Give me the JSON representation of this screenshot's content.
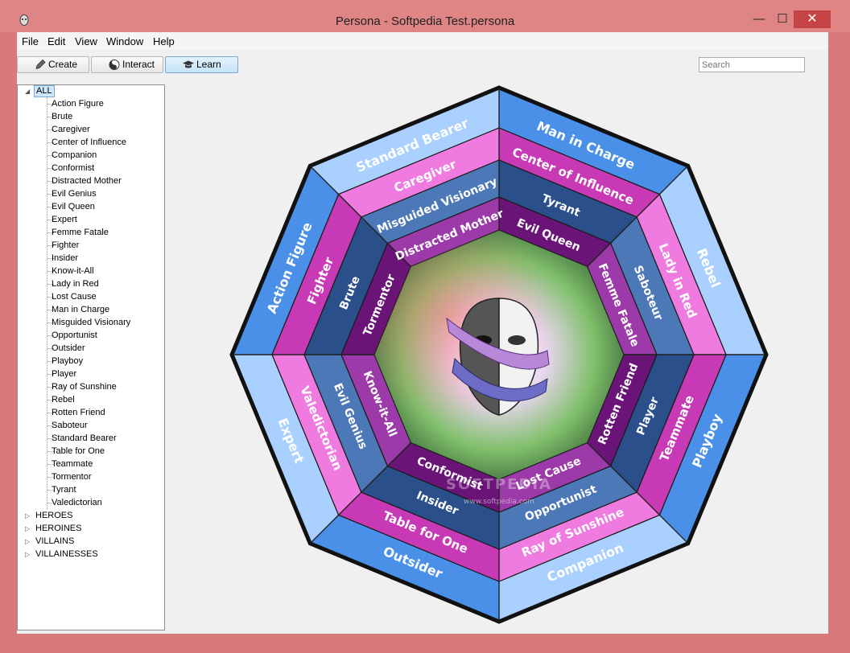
{
  "window": {
    "title": "Persona - Softpedia Test.persona",
    "minimize": "—",
    "maximize": "☐",
    "close": "✕"
  },
  "menu": [
    "File",
    "Edit",
    "View",
    "Window",
    "Help"
  ],
  "toolbar": {
    "buttons": [
      {
        "label": "Create",
        "icon": "pencil-icon"
      },
      {
        "label": "Interact",
        "icon": "yin-yang-icon"
      },
      {
        "label": "Learn",
        "icon": "graduation-cap-icon"
      }
    ],
    "active": "Learn"
  },
  "search": {
    "placeholder": "Search"
  },
  "tree": {
    "root": "ALL",
    "items": [
      "Action Figure",
      "Brute",
      "Caregiver",
      "Center of Influence",
      "Companion",
      "Conformist",
      "Distracted Mother",
      "Evil Genius",
      "Evil Queen",
      "Expert",
      "Femme Fatale",
      "Fighter",
      "Insider",
      "Know-it-All",
      "Lady in Red",
      "Lost Cause",
      "Man in Charge",
      "Misguided Visionary",
      "Opportunist",
      "Outsider",
      "Playboy",
      "Player",
      "Ray of Sunshine",
      "Rebel",
      "Rotten Friend",
      "Saboteur",
      "Standard Bearer",
      "Table for One",
      "Teammate",
      "Tormentor",
      "Tyrant",
      "Valedictorian"
    ],
    "groups": [
      "HEROES",
      "HEROINES",
      "VILLAINS",
      "VILLAINESSES"
    ]
  },
  "wheel": {
    "outer_ring": [
      "Man in Charge",
      "Rebel",
      "Playboy",
      "Companion",
      "Outsider",
      "Expert",
      "Action Figure",
      "Standard Bearer"
    ],
    "ring2": [
      "Center of Influence",
      "Lady in Red",
      "Teammate",
      "Ray of Sunshine",
      "Table for One",
      "Valedictorian",
      "Fighter",
      "Caregiver"
    ],
    "ring3": [
      "Tyrant",
      "Saboteur",
      "Player",
      "Opportunist",
      "Insider",
      "Evil Genius",
      "Brute",
      "Misguided Visionary"
    ],
    "ring4": [
      "Evil Queen",
      "Femme Fatale",
      "Rotten Friend",
      "Lost Cause",
      "Conformist",
      "Know-it-All",
      "Tormentor",
      "Distracted Mother"
    ],
    "colors": {
      "outer": "#4a8fe8",
      "ring2": "#c83ab5",
      "ring3": "#2a4f8a",
      "ring4": "#6a1478",
      "frame": "#111111"
    },
    "center_icon": "theater-mask-icon",
    "watermark": "SOFTPEDIA",
    "watermark_url": "www.softpedia.com"
  }
}
